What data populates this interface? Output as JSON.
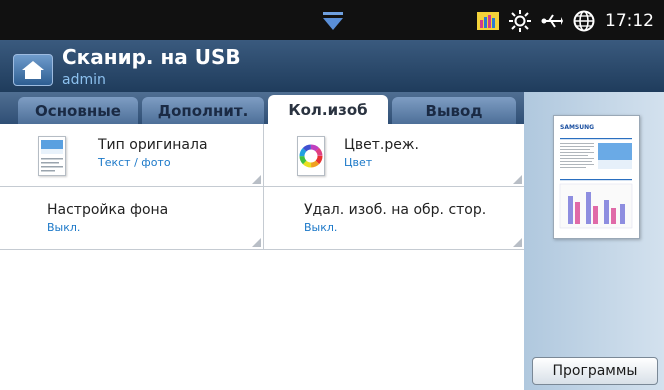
{
  "status": {
    "clock": "17:12",
    "icons": [
      "menu-down-arrow-icon",
      "signal-bars-icon",
      "sun-icon",
      "usb-icon",
      "globe-icon"
    ]
  },
  "header": {
    "title": "Сканир. на USB",
    "user": "admin"
  },
  "tabs": [
    {
      "label": "Основные",
      "active": false
    },
    {
      "label": "Дополнит.",
      "active": false
    },
    {
      "label": "Кол.изоб",
      "active": true
    },
    {
      "label": "Вывод",
      "active": false
    }
  ],
  "options": [
    {
      "label": "Тип оригинала",
      "value": "Текст / фото",
      "icon": "original-type-icon"
    },
    {
      "label": "Цвет.реж.",
      "value": "Цвет",
      "icon": "color-wheel-icon"
    },
    {
      "label": "Настройка фона",
      "value": "Выкл."
    },
    {
      "label": "Удал. изоб. на обр. стор.",
      "value": "Выкл."
    }
  ],
  "side": {
    "preview_brand": "SAMSUNG",
    "programs_button": "Программы"
  },
  "colors": {
    "header": "#2b4a6e",
    "value_text": "#1b78c8",
    "side_panel": "#c4d6e7"
  }
}
